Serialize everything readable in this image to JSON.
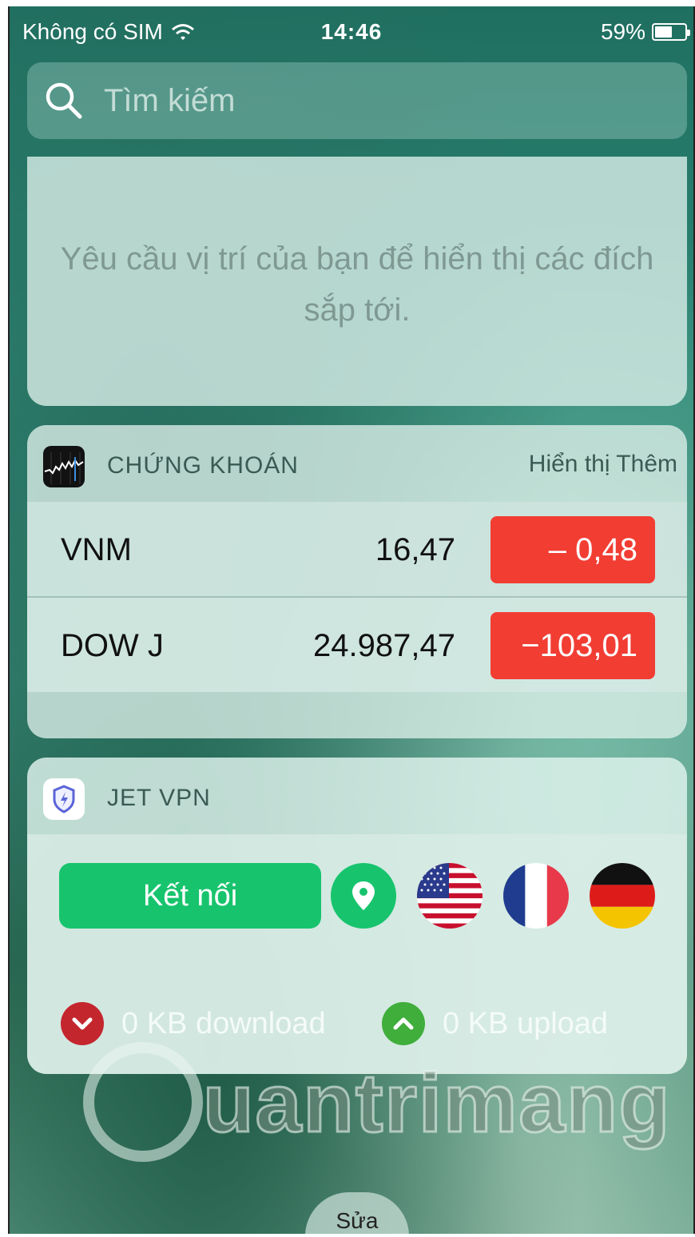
{
  "status_bar": {
    "carrier": "Không có SIM",
    "time": "14:46",
    "battery": "59%",
    "battery_level": 0.59
  },
  "search": {
    "placeholder": "Tìm kiếm"
  },
  "location_widget": {
    "message": "Yêu cầu vị trí của bạn để hiển thị các đích sắp tới."
  },
  "stocks_widget": {
    "title": "CHỨNG KHOÁN",
    "more_label": "Hiển thị Thêm",
    "rows": [
      {
        "symbol": "VNM",
        "price": "16,47",
        "change": "–   0,48"
      },
      {
        "symbol": "DOW J",
        "price": "24.987,47",
        "change": "−103,01"
      }
    ],
    "change_color": "#f23d33"
  },
  "vpn_widget": {
    "title": "JET VPN",
    "connect_label": "Kết nối",
    "download": "0 KB download",
    "upload": "0 KB upload",
    "accent_color": "#17c46d",
    "flags": [
      "us-flag",
      "france-flag",
      "germany-flag"
    ]
  },
  "watermark": {
    "text": "uantrimang"
  },
  "edit": {
    "label": "Sửa"
  }
}
